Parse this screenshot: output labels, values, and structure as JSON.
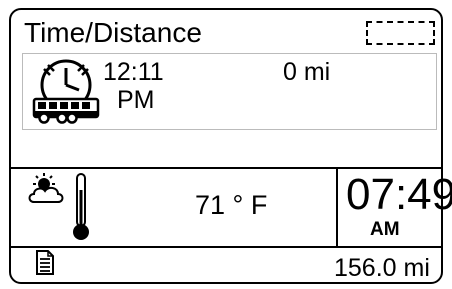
{
  "header": {
    "title": "Time/Distance",
    "indicator_icon": "dashed-box"
  },
  "trip": {
    "icon": "clock-bus-icon",
    "time": "12:11",
    "time_period": "PM",
    "distance": "0 mi"
  },
  "status": {
    "weather_icon": "sun-cloud-icon",
    "thermometer_icon": "thermometer-icon",
    "temperature": "71 ° F",
    "clock_time": "07:49",
    "clock_period": "AM"
  },
  "footer": {
    "icon": "document-icon",
    "odometer": "156.0 mi"
  }
}
